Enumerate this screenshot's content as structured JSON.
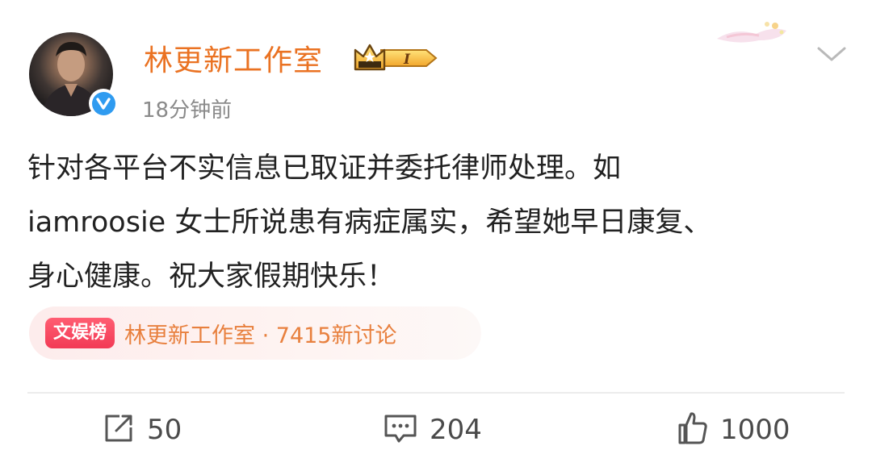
{
  "post": {
    "username": "林更新工作室",
    "vip_level": "I",
    "timestamp": "18分钟前",
    "text_lines": [
      "针对各平台不实信息已取证并委托律师处理。如",
      "iamroosie 女士所说患有病症属实，希望她早日康复、",
      "身心健康。祝大家假期快乐！"
    ],
    "topic": {
      "tag": "文娱榜",
      "text": "林更新工作室 · 7415新讨论"
    }
  },
  "actions": {
    "repost_count": "50",
    "comment_count": "204",
    "like_count": "1000"
  },
  "icons": {
    "avatar": "avatar-photo",
    "verify": "verified-v-icon",
    "vip": "crown-vip-icon",
    "menu": "chevron-down-icon",
    "repost": "repost-icon",
    "comment": "comment-icon",
    "like": "thumbs-up-icon"
  },
  "colors": {
    "username": "#ea7222",
    "verify": "#2f9bf0",
    "topic_tag": "#f23a55",
    "topic_text": "#e8803e",
    "body_text": "#222222",
    "meta_text": "#8a8a8a"
  }
}
